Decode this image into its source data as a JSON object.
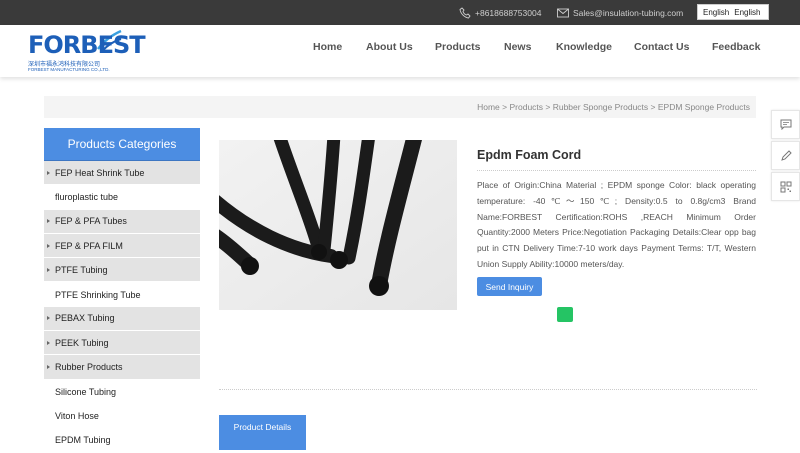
{
  "topbar": {
    "phone": "+8618688753004",
    "email": "Sales@insulation-tubing.com",
    "language_label": "English",
    "language_selected": "English"
  },
  "logo": {
    "wordmark": "FORBEST",
    "cn_name": "深圳市福永鸿科技有限公司",
    "en_name": "FORBEST MANUFACTURING CO.,LTD."
  },
  "nav": {
    "items": [
      {
        "label": "Home"
      },
      {
        "label": "About Us"
      },
      {
        "label": "Products"
      },
      {
        "label": "News"
      },
      {
        "label": "Knowledge"
      },
      {
        "label": "Contact Us"
      },
      {
        "label": "Feedback"
      }
    ]
  },
  "breadcrumb": {
    "items": [
      "Home",
      "Products",
      "Rubber Sponge Products",
      "EPDM Sponge Products"
    ],
    "separator": " > "
  },
  "sidebar": {
    "title": "Products Categories",
    "items": [
      {
        "label": "FEP Heat Shrink Tube",
        "type": "category"
      },
      {
        "label": "fluroplastic tube",
        "type": "sub"
      },
      {
        "label": "FEP & PFA Tubes",
        "type": "category"
      },
      {
        "label": "FEP & PFA FILM",
        "type": "category"
      },
      {
        "label": "PTFE Tubing",
        "type": "category"
      },
      {
        "label": "PTFE Shrinking Tube",
        "type": "sub"
      },
      {
        "label": "PEBAX Tubing",
        "type": "category"
      },
      {
        "label": "PEEK Tubing",
        "type": "category"
      },
      {
        "label": "Rubber Products",
        "type": "category"
      },
      {
        "label": "Silicone Tubing",
        "type": "sub"
      },
      {
        "label": "Viton Hose",
        "type": "sub"
      },
      {
        "label": "EPDM Tubing",
        "type": "sub"
      }
    ]
  },
  "product": {
    "title": "Epdm Foam Cord",
    "description": "Place of Origin:China Material ; EPDM sponge Color: black operating temperature: -40℃～150℃; Density:0.5 to 0.8g/cm3 Brand Name:FORBEST Certification:ROHS ,REACH Minimum Order Quantity:2000 Meters Price:Negotiation Packaging Details:Clear opp bag put in CTN Delivery Time:7-10 work days Payment Terms: T/T, Western Union Supply Ability:10000 meters/day.",
    "inquiry_label": "Send Inquiry",
    "tab_label": "Product Details"
  },
  "floatbar": {
    "icons": [
      "message-icon",
      "edit-icon",
      "qr-code-icon"
    ]
  },
  "colors": {
    "accent": "#4c8de2",
    "topbar": "#3a3a3a",
    "share_green": "#25c464",
    "logo_blue": "#1d5fb8"
  }
}
